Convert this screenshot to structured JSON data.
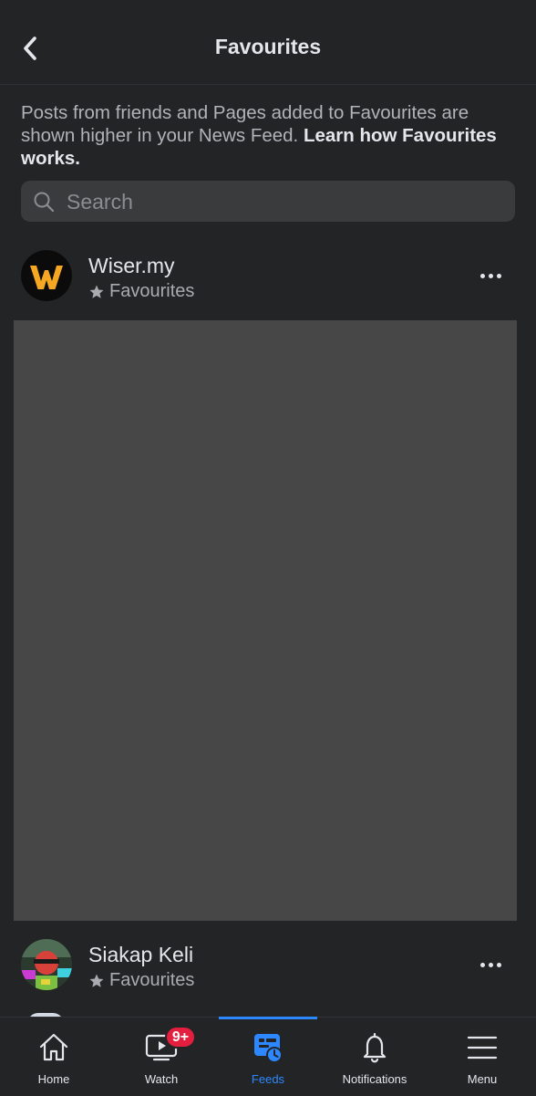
{
  "header": {
    "title": "Favourites",
    "back_icon": "chevron-left-icon"
  },
  "intro": {
    "text": "Posts from friends and Pages added to Favourites are shown higher in your News Feed.",
    "link": "Learn how Favourites works."
  },
  "search": {
    "placeholder": "Search",
    "value": "",
    "icon": "search-icon"
  },
  "favourites": [
    {
      "name": "Wiser.my",
      "subtitle": "Favourites"
    },
    {
      "name": "Siakap Keli",
      "subtitle": "Favourites"
    }
  ],
  "tabbar": {
    "tabs": [
      {
        "label": "Home",
        "icon": "home-icon"
      },
      {
        "label": "Watch",
        "icon": "watch-icon",
        "badge": "9+"
      },
      {
        "label": "Feeds",
        "icon": "feeds-icon",
        "active": true
      },
      {
        "label": "Notifications",
        "icon": "bell-icon"
      },
      {
        "label": "Menu",
        "icon": "hamburger-menu-icon"
      }
    ]
  },
  "colors": {
    "background": "#232426",
    "accent": "#2d88ff",
    "badge": "#e41e3f",
    "media_placeholder": "#474747"
  }
}
